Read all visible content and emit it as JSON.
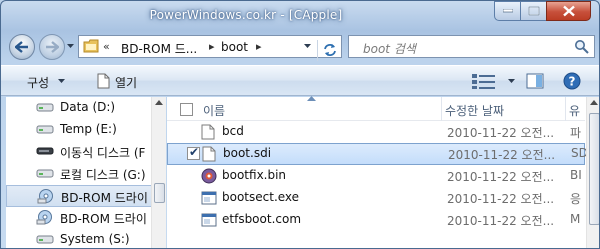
{
  "window": {
    "title": "PowerWindows.co.kr - [CApple]"
  },
  "address": {
    "crumbs": [
      "BD-ROM 드...",
      "boot"
    ]
  },
  "search": {
    "placeholder": "boot 검색"
  },
  "toolbar": {
    "organize_label": "구성",
    "open_label": "열기"
  },
  "nav_items": [
    {
      "label": "Data (D:)",
      "icon": "hard-drive-icon"
    },
    {
      "label": "Temp (E:)",
      "icon": "hard-drive-icon"
    },
    {
      "label": "이동식 디스크 (F",
      "icon": "removable-drive-icon"
    },
    {
      "label": "로컬 디스크 (G:)",
      "icon": "hard-drive-icon"
    },
    {
      "label": "BD-ROM 드라이",
      "icon": "bd-rom-icon",
      "selected": true
    },
    {
      "label": "BD-ROM 드라이",
      "icon": "bd-rom-icon"
    },
    {
      "label": "System (S:)",
      "icon": "hard-drive-icon"
    }
  ],
  "columns": {
    "name": "이름",
    "date": "수정한 날짜",
    "type": "유"
  },
  "files": [
    {
      "name": "bcd",
      "date": "2010-11-22 오전...",
      "type": "파",
      "icon": "file-icon",
      "checked": false
    },
    {
      "name": "boot.sdi",
      "date": "2010-11-22 오전...",
      "type": "SD",
      "icon": "file-icon",
      "checked": true,
      "selected": true
    },
    {
      "name": "bootfix.bin",
      "date": "2010-11-22 오전...",
      "type": "BI",
      "icon": "bin-file-icon",
      "checked": false
    },
    {
      "name": "bootsect.exe",
      "date": "2010-11-22 오전...",
      "type": "응",
      "icon": "exe-file-icon",
      "checked": false
    },
    {
      "name": "etfsboot.com",
      "date": "2010-11-22 오전...",
      "type": "M",
      "icon": "com-file-icon",
      "checked": false
    }
  ]
}
